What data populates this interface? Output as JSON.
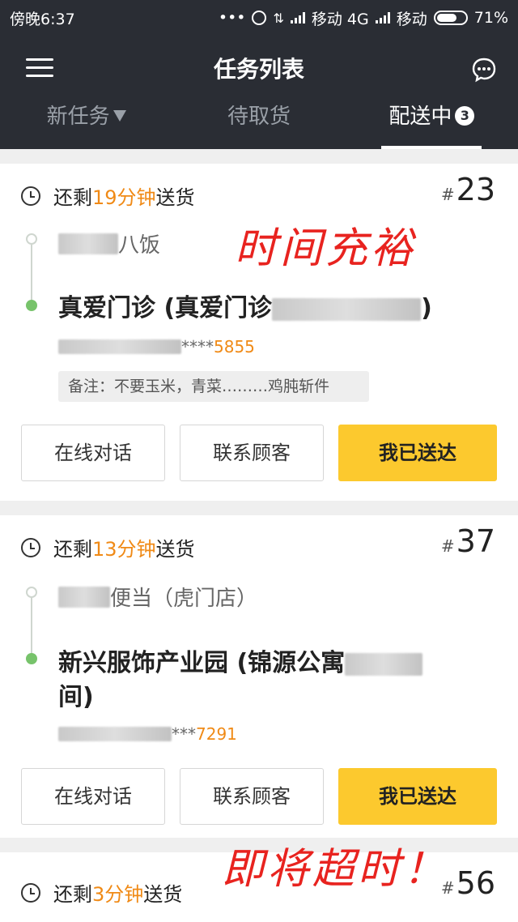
{
  "statusbar": {
    "time": "傍晚6:37",
    "icons_text": "•••",
    "carrier1": "移动 4G",
    "carrier2": "移动",
    "battery": "71%",
    "battery_level": 0.71
  },
  "header": {
    "title": "任务列表",
    "tabs": [
      {
        "label": "新任务"
      },
      {
        "label": "待取货"
      },
      {
        "label": "配送中",
        "badge": "3"
      }
    ]
  },
  "orders": [
    {
      "time_prefix": "还剩",
      "time_value": "19分钟",
      "time_suffix": "送货",
      "hash": "#",
      "order_no": "23",
      "shop": "八饭",
      "dest": "真爱门诊 (真爱门诊",
      "dest_end": ")",
      "phone_mask": "****",
      "phone_tail": "5855",
      "note": "备注：不要玉米，青菜………鸡肫斩件",
      "buttons": [
        "在线对话",
        "联系顾客",
        "我已送达"
      ]
    },
    {
      "time_prefix": "还剩",
      "time_value": "13分钟",
      "time_suffix": "送货",
      "hash": "#",
      "order_no": "37",
      "shop": "便当（虎门店）",
      "dest": "新兴服饰产业园 (锦源公寓",
      "dest_line2": "间)",
      "phone_mask": "***",
      "phone_tail": "7291",
      "buttons": [
        "在线对话",
        "联系顾客",
        "我已送达"
      ]
    },
    {
      "time_prefix": "还剩",
      "time_value": "3分钟",
      "time_suffix": "送货",
      "hash": "#",
      "order_no": "56"
    }
  ],
  "annotations": {
    "ample": "时间充裕",
    "timeout": "即将超时！"
  }
}
